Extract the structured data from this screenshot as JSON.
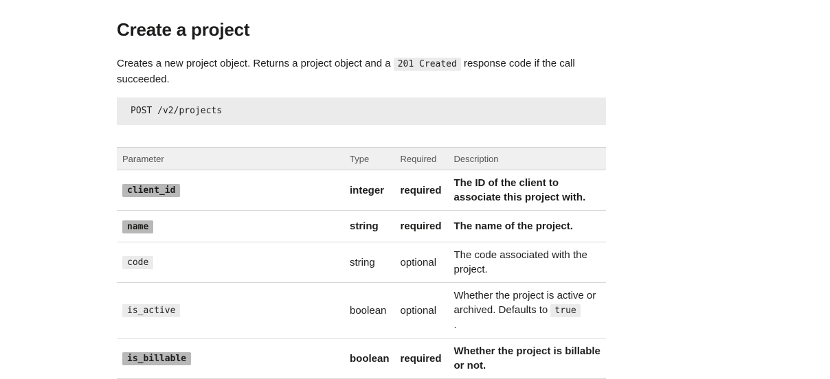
{
  "page": {
    "title": "Create a project",
    "intro_before": "Creates a new project object. Returns a project object and a ",
    "intro_code": "201 Created",
    "intro_after": " response code if the call succeeded.",
    "endpoint": "POST /v2/projects"
  },
  "table": {
    "headers": [
      "Parameter",
      "Type",
      "Required",
      "Description"
    ],
    "rows": [
      {
        "param": "client_id",
        "type": "integer",
        "required": "required",
        "description": "The ID of the client to associate this project with."
      },
      {
        "param": "name",
        "type": "string",
        "required": "required",
        "description": "The name of the project."
      },
      {
        "param": "code",
        "type": "string",
        "required": "optional",
        "description": "The code associated with the project."
      },
      {
        "param": "is_active",
        "type": "boolean",
        "required": "optional",
        "description_before": "Whether the project is active or archived. Defaults to ",
        "description_code": "true",
        "description_after": "."
      },
      {
        "param": "is_billable",
        "type": "boolean",
        "required": "required",
        "description": "Whether the project is billable or not."
      }
    ]
  }
}
